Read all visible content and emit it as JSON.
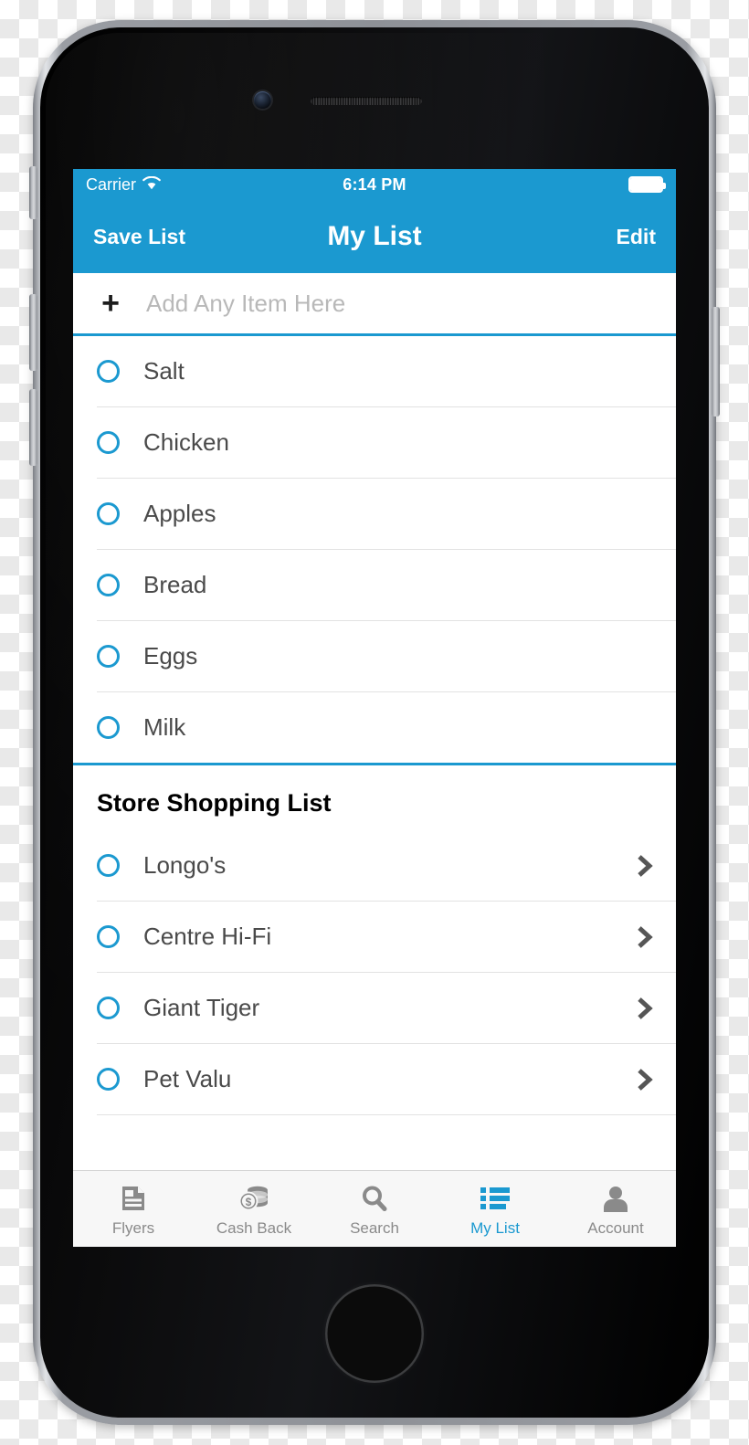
{
  "device": {
    "name": "iphone-mockup",
    "camera": "camera-icon",
    "speaker": "speaker-grille",
    "home_button": "home-button",
    "buttons": [
      "silent-switch",
      "volume-up-button",
      "volume-down-button",
      "power-button"
    ]
  },
  "colors": {
    "accent": "#1b99d0",
    "nav_text": "#ffffff",
    "row_text": "#4a4a4a",
    "placeholder": "#b8b8b8",
    "tab_inactive": "#8a8a8a",
    "separator": "#e2e2e2",
    "tab_bar_bg": "#f7f7f7"
  },
  "status_bar": {
    "carrier": "Carrier",
    "wifi_icon": "wifi-icon",
    "time": "6:14 PM",
    "battery_icon": "battery-full-icon"
  },
  "nav_bar": {
    "left_button": "Save List",
    "title": "My List",
    "right_button": "Edit"
  },
  "add_row": {
    "plus_icon": "plus-icon",
    "placeholder": "Add Any Item Here",
    "value": ""
  },
  "items": [
    {
      "label": "Salt",
      "checked": false
    },
    {
      "label": "Chicken",
      "checked": false
    },
    {
      "label": "Apples",
      "checked": false
    },
    {
      "label": "Bread",
      "checked": false
    },
    {
      "label": "Eggs",
      "checked": false
    },
    {
      "label": "Milk",
      "checked": false
    }
  ],
  "store_section": {
    "header": "Store Shopping List",
    "stores": [
      {
        "label": "Longo's",
        "checked": false,
        "chevron": "chevron-right-icon"
      },
      {
        "label": "Centre Hi-Fi",
        "checked": false,
        "chevron": "chevron-right-icon"
      },
      {
        "label": "Giant Tiger",
        "checked": false,
        "chevron": "chevron-right-icon"
      },
      {
        "label": "Pet Valu",
        "checked": false,
        "chevron": "chevron-right-icon"
      }
    ]
  },
  "tab_bar": {
    "tabs": [
      {
        "label": "Flyers",
        "icon": "flyer-document-icon",
        "active": false
      },
      {
        "label": "Cash Back",
        "icon": "coins-dollar-icon",
        "active": false
      },
      {
        "label": "Search",
        "icon": "search-icon",
        "active": false
      },
      {
        "label": "My List",
        "icon": "list-icon",
        "active": true
      },
      {
        "label": "Account",
        "icon": "person-icon",
        "active": false
      }
    ]
  }
}
